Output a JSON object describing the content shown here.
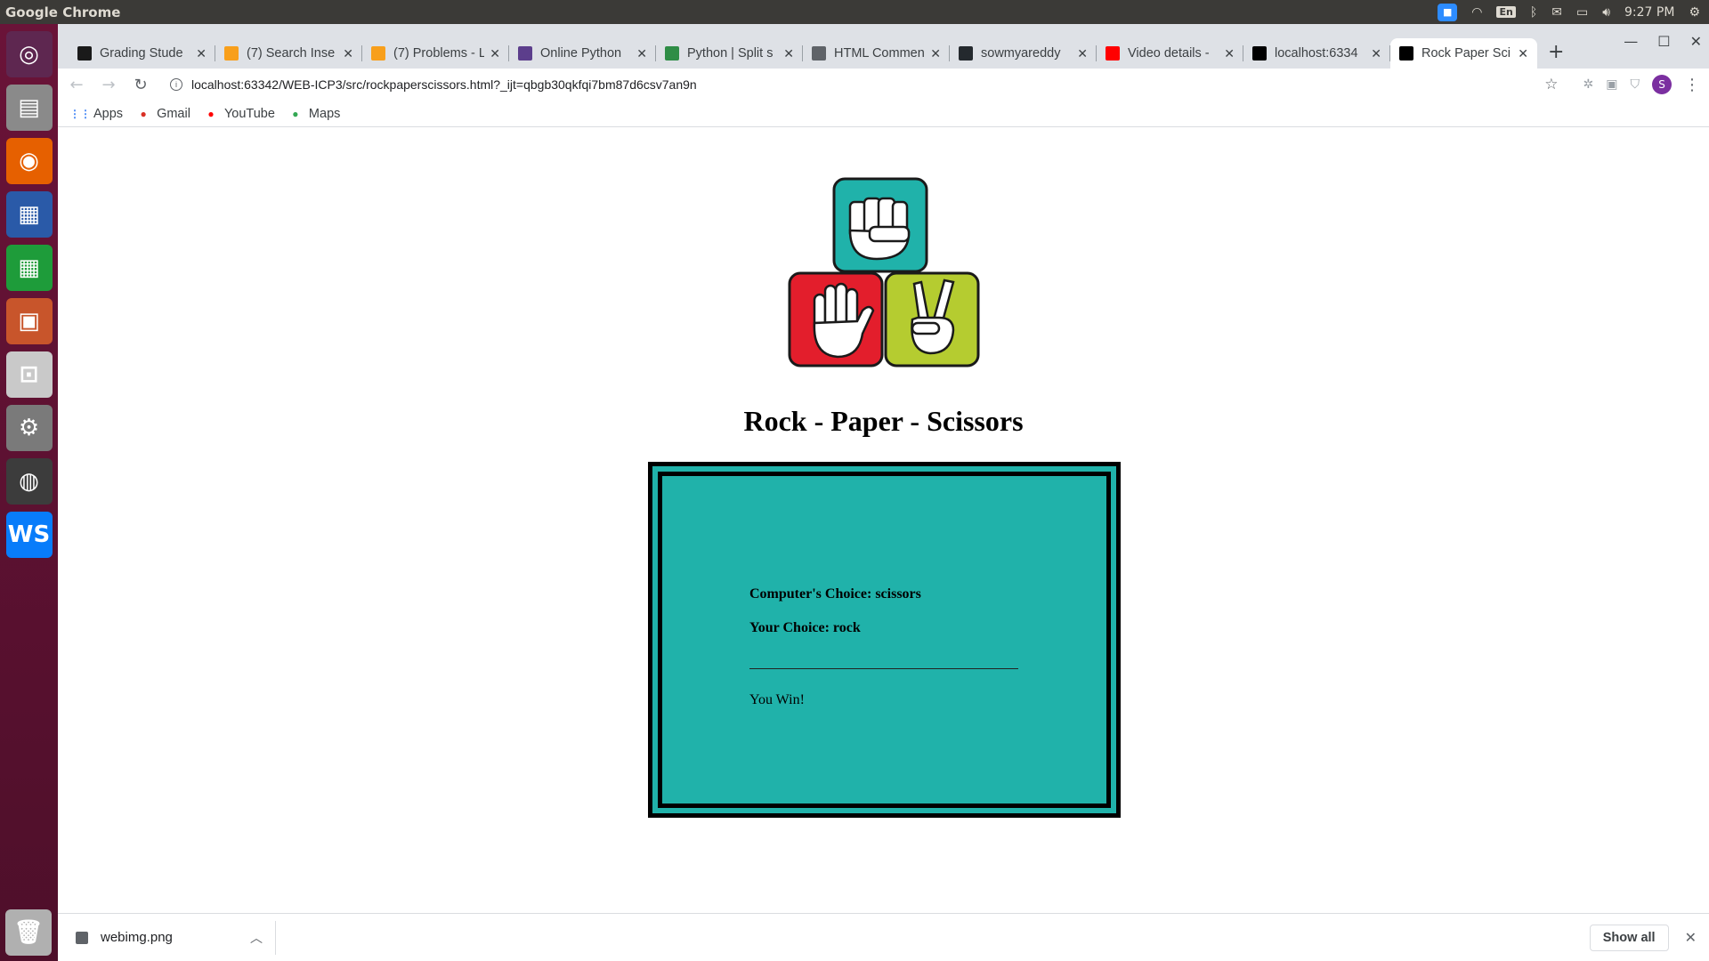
{
  "system": {
    "app_name": "Google Chrome",
    "clock": "9:27 PM",
    "lang": "En"
  },
  "tabs": [
    {
      "title": "Grading Stude",
      "favicon": "blackboard-icon",
      "color": "#1a1a1a"
    },
    {
      "title": "(7) Search Inse",
      "favicon": "leetcode-icon",
      "color": "#f89f1b"
    },
    {
      "title": "(7) Problems - L",
      "favicon": "leetcode-icon",
      "color": "#f89f1b"
    },
    {
      "title": "Online Python",
      "favicon": "replit-icon",
      "color": "#5c3e8c"
    },
    {
      "title": "Python | Split s",
      "favicon": "geeksforgeeks-icon",
      "color": "#2f8d46"
    },
    {
      "title": "HTML Commen",
      "favicon": "shield-icon",
      "color": "#5f6368"
    },
    {
      "title": "sowmyareddy",
      "favicon": "github-icon",
      "color": "#24292e"
    },
    {
      "title": "Video details -",
      "favicon": "youtube-icon",
      "color": "#ff0000"
    },
    {
      "title": "localhost:6334",
      "favicon": "webstorm-icon",
      "color": "#000000"
    },
    {
      "title": "Rock Paper Sci",
      "favicon": "webstorm-icon",
      "color": "#000000"
    }
  ],
  "address": {
    "url": "localhost:63342/WEB-ICP3/src/rockpaperscissors.html?_ijt=qbgb30qkfqi7bm87d6csv7an9n"
  },
  "bookmarks": [
    {
      "label": "Apps",
      "icon": "apps-grid-icon",
      "color": "#4285f4"
    },
    {
      "label": "Gmail",
      "icon": "gmail-icon",
      "color": "#d93025"
    },
    {
      "label": "YouTube",
      "icon": "youtube-icon",
      "color": "#ff0000"
    },
    {
      "label": "Maps",
      "icon": "maps-icon",
      "color": "#34a853"
    }
  ],
  "profile_initial": "S",
  "game": {
    "title": "Rock - Paper - Scissors",
    "computer_choice": "Computer's Choice: scissors",
    "your_choice": "Your Choice: rock",
    "result": "You Win!",
    "colors": {
      "box": "#20b2aa",
      "rock": "#20b2aa",
      "paper": "#e31e2c",
      "scissors": "#b5cc30"
    }
  },
  "download": {
    "filename": "webimg.png",
    "show_all": "Show all"
  }
}
